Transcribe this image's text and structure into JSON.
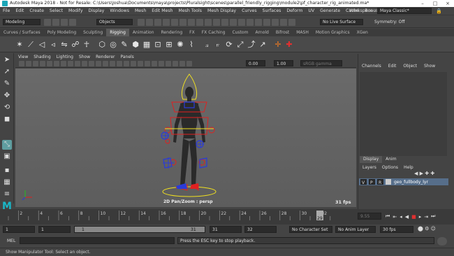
{
  "window": {
    "title": "Autodesk Maya 2018 - Not for Resale: C:\\Users\\Joshua\\Documents\\maya\\projects\\Pluralsight\\scenes\\parallel_friendly_rigging\\module2\\pf_character_rig_animated.ma*"
  },
  "menubar": {
    "items": [
      "File",
      "Edit",
      "Create",
      "Select",
      "Modify",
      "Display",
      "Windows",
      "Mesh",
      "Edit Mesh",
      "Mesh Tools",
      "Mesh Display",
      "Curves",
      "Surfaces",
      "Deform",
      "UV",
      "Generate",
      "Cache",
      "Bonus Tools"
    ],
    "workspace_label": "Workspace :",
    "workspace_value": "Maya Classic*"
  },
  "statusline": {
    "mode": "Modeling",
    "objects": "Objects",
    "live_surface": "No Live Surface",
    "symmetry": "Symmetry: Off"
  },
  "shelf": {
    "tabs": [
      "Curves / Surfaces",
      "Poly Modeling",
      "Sculpting",
      "Rigging",
      "Animation",
      "Rendering",
      "FX",
      "FX Caching",
      "Custom",
      "Arnold",
      "Bifrost",
      "MASH",
      "Motion Graphics",
      "XGen"
    ],
    "active_tab": "Rigging"
  },
  "viewport": {
    "menu": [
      "View",
      "Shading",
      "Lighting",
      "Show",
      "Renderer",
      "Panels"
    ],
    "field1": "0.00",
    "field2": "1.00",
    "color_space": "sRGB gamma",
    "hud_label": "2D Pan/Zoom : persp",
    "fps": "31 fps"
  },
  "channelbox": {
    "menu": [
      "Channels",
      "Edit",
      "Object",
      "Show"
    ],
    "layer_tabs": [
      "Display",
      "Anim"
    ],
    "layer_menu": [
      "Layers",
      "Options",
      "Help"
    ],
    "layer": {
      "v": "V",
      "p": "P",
      "r": "R",
      "name": "geo_fullbody_lyr"
    }
  },
  "timeline": {
    "ticks": [
      "2",
      "4",
      "6",
      "8",
      "10",
      "12",
      "14",
      "16",
      "18",
      "20",
      "22",
      "24",
      "26",
      "28",
      "30",
      "32"
    ],
    "current_frame": "29",
    "current_field": "9.55"
  },
  "range": {
    "start": "1",
    "playback_start": "1",
    "slider_left": "1",
    "slider_right": "31",
    "playback_end": "31",
    "end": "32",
    "character_set": "No Character Set",
    "anim_layer": "No Anim Layer",
    "fps_select": "30 fps"
  },
  "commandline": {
    "label": "MEL",
    "result": "Press the ESC key to stop playback."
  },
  "helpline": {
    "text": "Show Manipulator Tool: Select an object."
  },
  "colors": {
    "accent": "#5f9ea0",
    "layer": "#566e8a",
    "rig_red": "#e02020",
    "rig_blue": "#2a3bd8",
    "rig_yellow": "#f0e020"
  }
}
